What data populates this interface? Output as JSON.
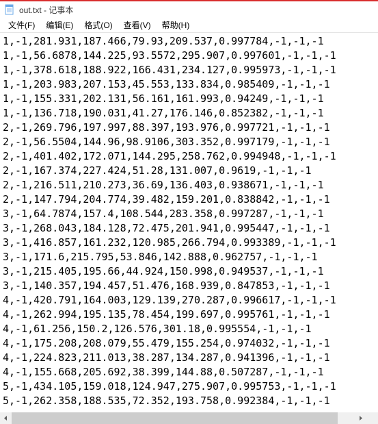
{
  "window": {
    "title": "out.txt - 记事本",
    "icon": "notepad-icon"
  },
  "menu": {
    "file": "文件(F)",
    "edit": "编辑(E)",
    "format": "格式(O)",
    "view": "查看(V)",
    "help": "帮助(H)"
  },
  "lines": [
    "1,-1,281.931,187.466,79.93,209.537,0.997784,-1,-1,-1",
    "1,-1,56.6878,144.225,93.5572,295.907,0.997601,-1,-1,-1",
    "1,-1,378.618,188.922,166.431,234.127,0.995973,-1,-1,-1",
    "1,-1,203.983,207.153,45.553,133.834,0.985409,-1,-1,-1",
    "1,-1,155.331,202.131,56.161,161.993,0.94249,-1,-1,-1",
    "1,-1,136.718,190.031,41.27,176.146,0.852382,-1,-1,-1",
    "2,-1,269.796,197.997,88.397,193.976,0.997721,-1,-1,-1",
    "2,-1,56.5504,144.96,98.9106,303.352,0.997179,-1,-1,-1",
    "2,-1,401.402,172.071,144.295,258.762,0.994948,-1,-1,-1",
    "2,-1,167.374,227.424,51.28,131.007,0.9619,-1,-1,-1",
    "2,-1,216.511,210.273,36.69,136.403,0.938671,-1,-1,-1",
    "2,-1,147.794,204.774,39.482,159.201,0.838842,-1,-1,-1",
    "3,-1,64.7874,157.4,108.544,283.358,0.997287,-1,-1,-1",
    "3,-1,268.043,184.128,72.475,201.941,0.995447,-1,-1,-1",
    "3,-1,416.857,161.232,120.985,266.794,0.993389,-1,-1,-1",
    "3,-1,171.6,215.795,53.846,142.888,0.962757,-1,-1,-1",
    "3,-1,215.405,195.66,44.924,150.998,0.949537,-1,-1,-1",
    "3,-1,140.357,194.457,51.476,168.939,0.847853,-1,-1,-1",
    "4,-1,420.791,164.003,129.139,270.287,0.996617,-1,-1,-1",
    "4,-1,262.994,195.135,78.454,199.697,0.995761,-1,-1,-1",
    "4,-1,61.256,150.2,126.576,301.18,0.995554,-1,-1,-1",
    "4,-1,175.208,208.079,55.479,155.254,0.974032,-1,-1,-1",
    "4,-1,224.823,211.013,38.287,134.287,0.941396,-1,-1,-1",
    "4,-1,155.668,205.692,38.399,144.88,0.507287,-1,-1,-1",
    "5,-1,434.105,159.018,124.947,275.907,0.995753,-1,-1,-1",
    "5,-1,262.358,188.535,72.352,193.758,0.992384,-1,-1,-1"
  ]
}
